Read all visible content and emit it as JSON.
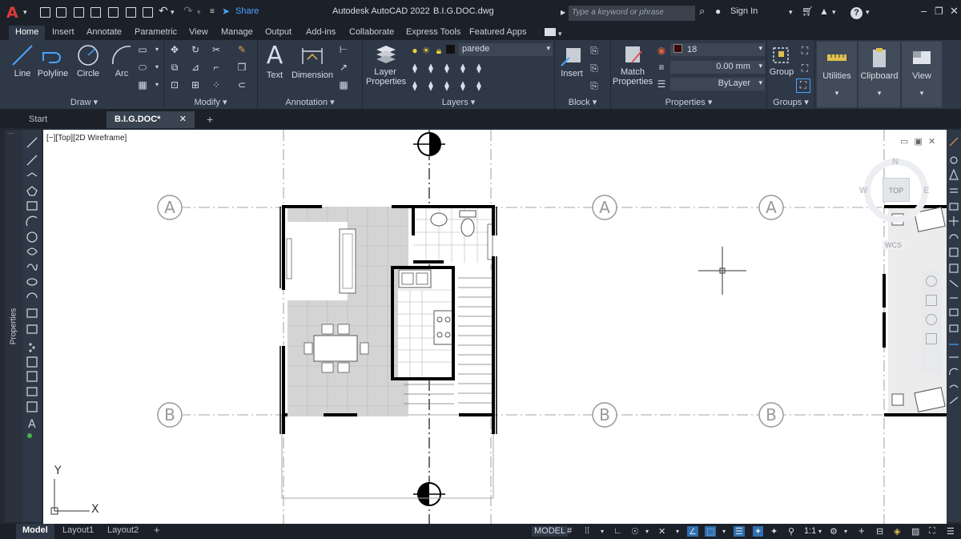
{
  "titlebar": {
    "app_title": "Autodesk AutoCAD 2022",
    "file_name": "B.I.G.DOC.dwg",
    "share_label": "Share",
    "search_placeholder": "Type a keyword or phrase",
    "signin_label": "Sign In"
  },
  "ribbon_tabs": [
    {
      "label": "Home",
      "active": true
    },
    {
      "label": "Insert"
    },
    {
      "label": "Annotate"
    },
    {
      "label": "Parametric"
    },
    {
      "label": "View"
    },
    {
      "label": "Manage"
    },
    {
      "label": "Output"
    },
    {
      "label": "Add-ins"
    },
    {
      "label": "Collaborate"
    },
    {
      "label": "Express Tools"
    },
    {
      "label": "Featured Apps"
    }
  ],
  "ribbon": {
    "draw": {
      "title": "Draw",
      "line": "Line",
      "polyline": "Polyline",
      "circle": "Circle",
      "arc": "Arc"
    },
    "modify": {
      "title": "Modify"
    },
    "annotation": {
      "title": "Annotation",
      "text": "Text",
      "dimension": "Dimension"
    },
    "layers": {
      "title": "Layers",
      "layer_properties_1": "Layer",
      "layer_properties_2": "Properties",
      "current_layer": "parede"
    },
    "block": {
      "title": "Block",
      "insert": "Insert"
    },
    "properties": {
      "title": "Properties",
      "match_1": "Match",
      "match_2": "Properties",
      "color_value": "18",
      "lineweight_value": "0.00 mm",
      "linetype_value": "ByLayer"
    },
    "groups": {
      "title": "Groups",
      "group": "Group"
    },
    "utilities": "Utilities",
    "clipboard": "Clipboard",
    "view": "View"
  },
  "doc_tabs": [
    {
      "label": "Start"
    },
    {
      "label": "B.I.G.DOC*",
      "active": true
    }
  ],
  "viewport": {
    "label": "[−][Top][2D Wireframe]",
    "viewcube_top": "TOP",
    "viewcube_n": "N",
    "viewcube_w": "W",
    "viewcube_e": "E",
    "wcs": "WCS"
  },
  "drawing": {
    "grid_a": "A",
    "grid_b": "B",
    "ucs_x": "X",
    "ucs_y": "Y"
  },
  "statusbar": {
    "layouts": [
      {
        "label": "Model",
        "active": true
      },
      {
        "label": "Layout1"
      },
      {
        "label": "Layout2"
      }
    ],
    "model_label": "MODEL",
    "scale_label": "1:1"
  },
  "sidebar": {
    "properties_label": "Properties"
  }
}
